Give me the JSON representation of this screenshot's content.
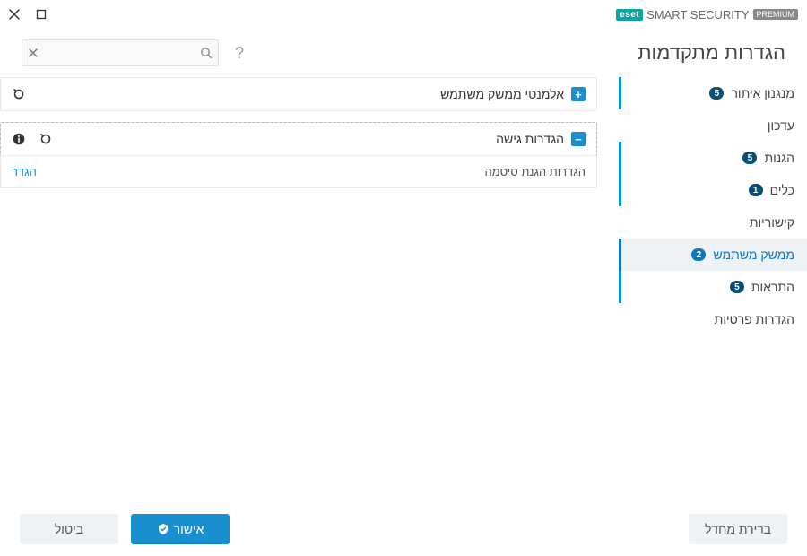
{
  "brand": {
    "logo": "eset",
    "name": "SMART SECURITY",
    "edition": "PREMIUM"
  },
  "page_title": "הגדרות מתקדמות",
  "search": {
    "placeholder": ""
  },
  "sidebar": {
    "items": [
      {
        "label": "מנגנון איתור",
        "badge": "5",
        "marked": true
      },
      {
        "label": "עדכון",
        "badge": "",
        "marked": false
      },
      {
        "label": "הגנות",
        "badge": "5",
        "marked": true
      },
      {
        "label": "כלים",
        "badge": "1",
        "marked": true
      },
      {
        "label": "קישוריות",
        "badge": "",
        "marked": false
      },
      {
        "label": "ממשק משתמש",
        "badge": "2",
        "marked": true,
        "active": true
      },
      {
        "label": "התראות",
        "badge": "5",
        "marked": true
      },
      {
        "label": "הגדרות פרטיות",
        "badge": "",
        "marked": false
      }
    ]
  },
  "panels": {
    "ui_elements": {
      "title": "אלמנטי ממשק משתמש",
      "expanded": false
    },
    "access": {
      "title": "הגדרות גישה",
      "expanded": true,
      "sub_label": "הגדרות הגנת סיסמה",
      "sub_action": "הגדר"
    }
  },
  "footer": {
    "default": "ברירת מחדל",
    "ok": "אישור",
    "cancel": "ביטול"
  }
}
